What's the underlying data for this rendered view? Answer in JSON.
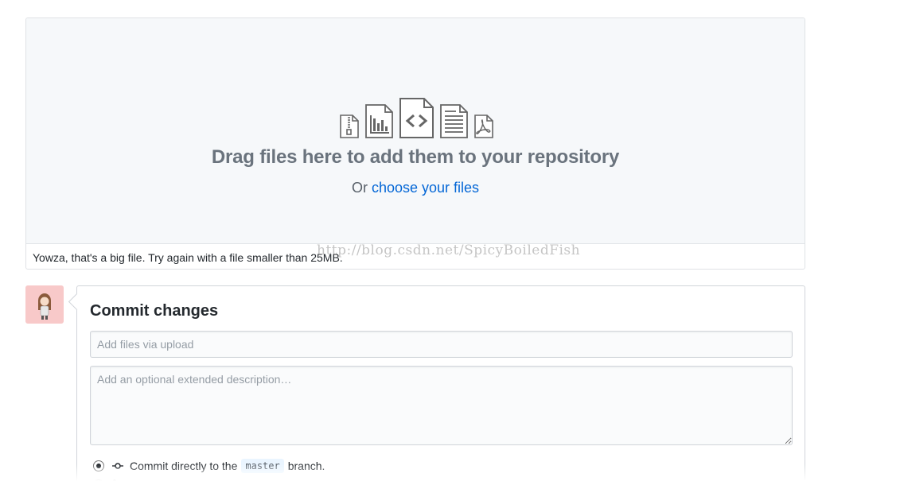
{
  "dropzone": {
    "title": "Drag files here to add them to your repository",
    "prefix": "Or",
    "choose_link": "choose your files",
    "error": "Yowza, that's a big file. Try again with a file smaller than 25MB.",
    "icons": [
      "file-zip-icon",
      "file-chart-icon",
      "file-code-icon",
      "file-text-icon",
      "file-pdf-icon"
    ]
  },
  "watermark": "http://blog.csdn.net/SpicyBoiledFish",
  "commit": {
    "title": "Commit changes",
    "summary_placeholder": "Add files via upload",
    "description_placeholder": "Add an optional extended description…",
    "option_direct_prefix": "Commit directly to the",
    "branch_name": "master",
    "option_direct_suffix": "branch.",
    "option_direct_selected": true,
    "option_new_branch_selected": false
  },
  "colors": {
    "link": "#0366d6",
    "avatar_bg": "#f8c9c9",
    "drop_bg": "#f6f8fa"
  }
}
